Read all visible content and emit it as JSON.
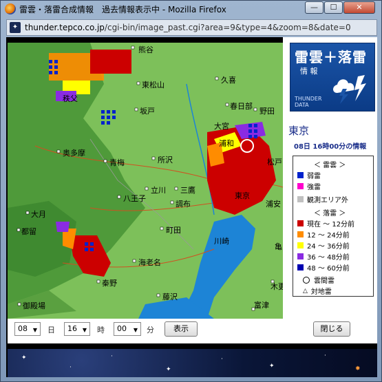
{
  "window": {
    "title": "雷雲・落雷合成情報　過去情報表示中 - Mozilla Firefox",
    "min_label": "—",
    "max_label": "☐",
    "close_label": "✕"
  },
  "address": {
    "domain": "thunder.tepco.co.jp",
    "path": "/cgi-bin/image_past.cgi?area=9&type=4&zoom=8&date=0"
  },
  "logo": {
    "title": "雷雲＋落雷",
    "subtitle": "情 報",
    "english_1": "THUNDER",
    "english_2": "DATA"
  },
  "info": {
    "area": "東京",
    "time": "08日 16時00分の情報"
  },
  "legend": {
    "cloud_header": "＜ 雷雲 ＞",
    "weak": "弱雷",
    "strong": "強雷",
    "outside": "観測エリア外",
    "strike_header": "＜ 落雷 ＞",
    "bands": [
      {
        "label": "現在 〜 12分前",
        "color": "#cc0000"
      },
      {
        "label": "12 〜 24分前",
        "color": "#ff8c00"
      },
      {
        "label": "24 〜 36分前",
        "color": "#ffff00"
      },
      {
        "label": "36 〜 48分前",
        "color": "#8a2be2"
      },
      {
        "label": "48 〜 60分前",
        "color": "#0000b0"
      }
    ],
    "intracloud": "雲間雷",
    "ground": "対地雷",
    "colors": {
      "weak": "#0022cc",
      "strong": "#ff00cc",
      "outside": "#c0c0c0"
    }
  },
  "map_labels": {
    "noukaku": "熊谷",
    "chichibu": "秩父",
    "higashimatsuyama": "東松山",
    "sakado": "坂戸",
    "kuki": "久喜",
    "kasukabe": "春日部",
    "noda": "野田",
    "omiya": "大宮",
    "urawa": "浦和",
    "matsudo": "松戸",
    "okutama": "奥多摩",
    "ome": "青梅",
    "tokorozawa": "所沢",
    "tachikawa": "立川",
    "mitaka": "三鷹",
    "hachioji": "八王子",
    "chofu": "調布",
    "tokyo": "東京",
    "urayasu": "浦安",
    "otsuki": "大月",
    "tsuru": "都留",
    "machida": "町田",
    "kawasaki": "川崎",
    "ebina": "海老名",
    "hadano": "秦野",
    "fujisawa": "藤沢",
    "gotemba": "御殿場",
    "kisarazu": "木更",
    "futtsu": "富津",
    "kamegawa": "亀"
  },
  "controls": {
    "day_value": "08",
    "day_unit": "日",
    "hour_value": "16",
    "hour_unit": "時",
    "minute_value": "00",
    "minute_unit": "分",
    "show_button": "表示",
    "close_button": "閉じる"
  }
}
